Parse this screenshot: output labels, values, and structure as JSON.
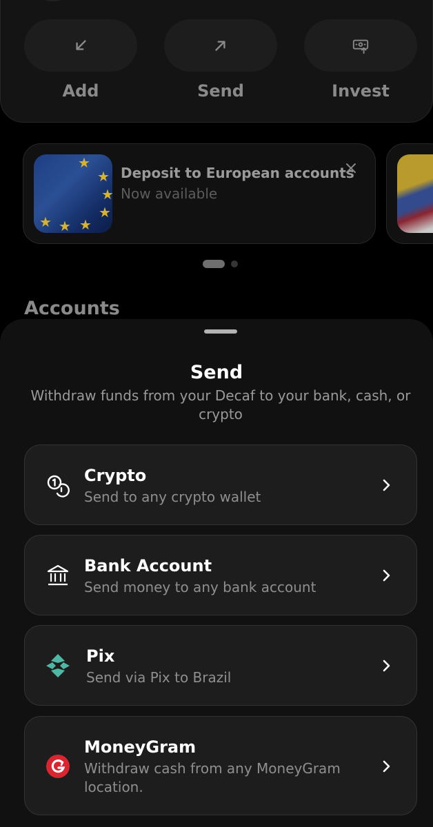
{
  "actions": [
    {
      "label": "Add",
      "icon": "arrow-down-left-icon"
    },
    {
      "label": "Send",
      "icon": "arrow-up-right-icon"
    },
    {
      "label": "Invest",
      "icon": "money-upload-icon"
    }
  ],
  "promo": {
    "title": "Deposit to European accounts",
    "subtitle": "Now available"
  },
  "carousel": {
    "pages": 2,
    "active": 1
  },
  "accounts_title": "Accounts",
  "sheet": {
    "title": "Send",
    "subtitle": "Withdraw funds from your Decaf to your bank, cash, or crypto",
    "options": [
      {
        "title": "Crypto",
        "subtitle": "Send to any crypto wallet",
        "icon": "coins-icon"
      },
      {
        "title": "Bank Account",
        "subtitle": "Send money to any bank account",
        "icon": "bank-icon"
      },
      {
        "title": "Pix",
        "subtitle": "Send via Pix to Brazil",
        "icon": "pix-icon",
        "accent": "#4fb8a5"
      },
      {
        "title": "MoneyGram",
        "subtitle": "Withdraw cash from any MoneyGram location.",
        "icon": "moneygram-icon",
        "accent": "#d9252f"
      }
    ]
  },
  "colors": {
    "background": "#000000",
    "sheet": "#111111",
    "option_card": "#1d1d1d",
    "text_primary": "#ffffff",
    "text_secondary": "#8f8f8f"
  }
}
